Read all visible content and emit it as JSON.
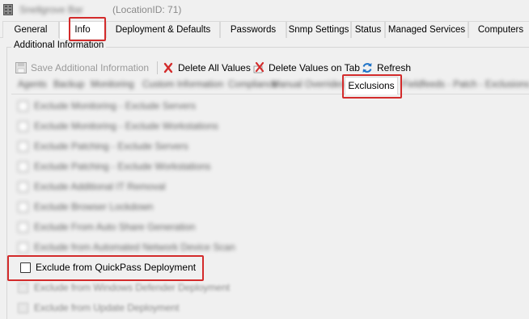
{
  "window": {
    "title_blurred": "Snellgrove Bar",
    "location_label": "(LocationID: 71)"
  },
  "tabs": [
    {
      "label": "General"
    },
    {
      "label": "Info"
    },
    {
      "label": "Deployment & Defaults"
    },
    {
      "label": "Passwords"
    },
    {
      "label": "Snmp Settings"
    },
    {
      "label": "Status"
    },
    {
      "label": "Managed Services"
    },
    {
      "label": "Computers"
    }
  ],
  "active_tab": "Info",
  "group": {
    "label": "Additional Information"
  },
  "toolbar": {
    "save_label": "Save Additional Information",
    "delete_all_label": "Delete All Values",
    "delete_tab_label": "Delete Values on Tab",
    "refresh_label": "Refresh"
  },
  "subtabs_blurred": [
    "Agents",
    "Backup",
    "Monitoring",
    "Custom Information",
    "Compliance",
    "Manual Overrides"
  ],
  "subtab_after_blurred": "Fieldfeeds - Patch - Exclusions",
  "active_subtab": "Exclusions",
  "options_blurred": [
    "Exclude Monitoring - Exclude Servers",
    "Exclude Monitoring - Exclude Workstations",
    "Exclude Patching - Exclude Servers",
    "Exclude Patching - Exclude Workstations",
    "Exclude Additional IT Removal",
    "Exclude Browser Lockdown",
    "Exclude From Auto Share Generation",
    "Exclude from Automated Network Device Scan"
  ],
  "highlighted_option": {
    "label": "Exclude from QuickPass Deployment",
    "checked": false
  },
  "options_after_blurred": [
    "Exclude from Windows Defender Deployment",
    "Exclude from Update Deployment"
  ],
  "colors": {
    "highlight": "#d32b2b",
    "delete": "#d32b2b",
    "refresh": "#1e73c8"
  }
}
